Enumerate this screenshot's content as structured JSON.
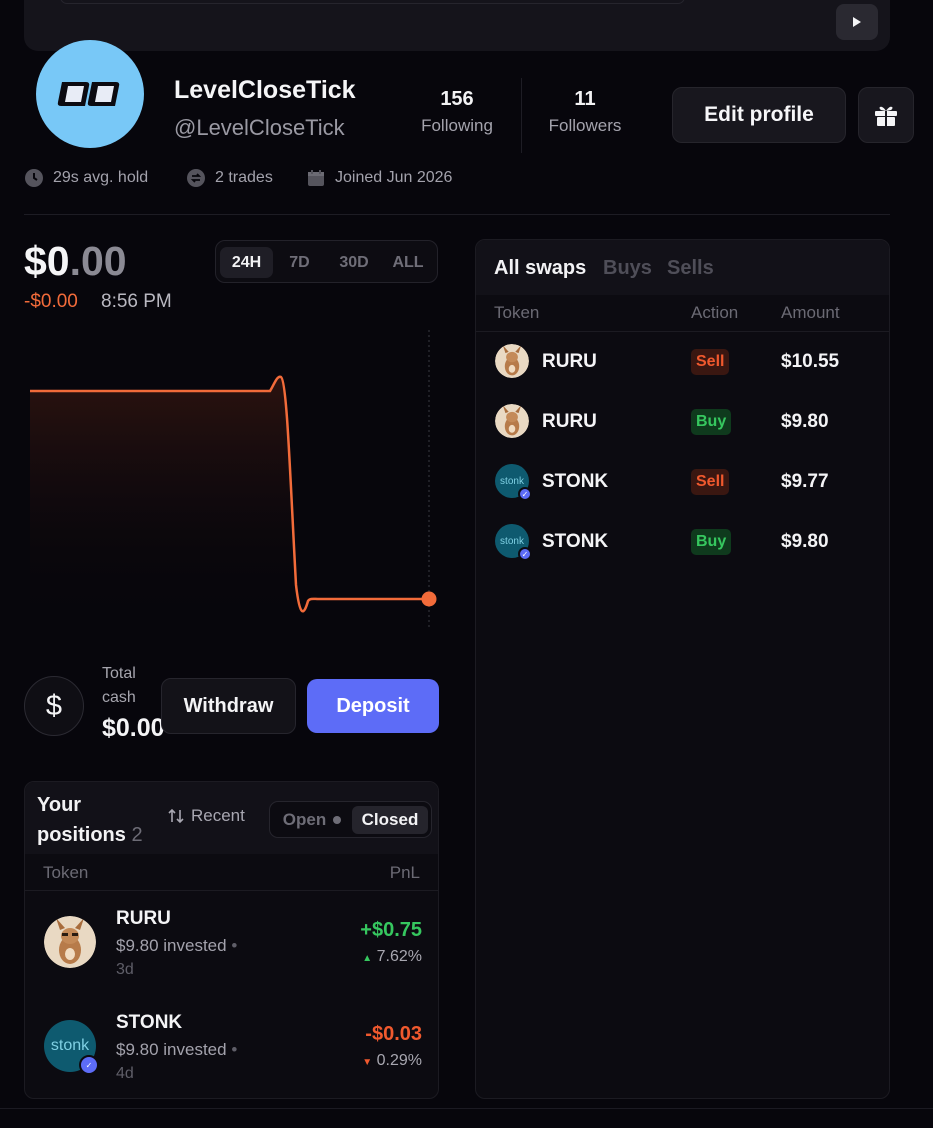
{
  "profile": {
    "name": "LevelCloseTick",
    "handle": "@LevelCloseTick",
    "following_count": "156",
    "following_label": "Following",
    "followers_count": "11",
    "followers_label": "Followers",
    "edit_label": "Edit profile",
    "avg_hold": "29s avg. hold",
    "trades": "2 trades",
    "joined": "Joined Jun 2026"
  },
  "portfolio": {
    "balance_main": "$0",
    "balance_cents": ".00",
    "delta": "-$0.00",
    "time": "8:56 PM",
    "ranges": [
      "24H",
      "7D",
      "30D",
      "ALL"
    ],
    "active_range": "24H",
    "line_color": "#f26b3a"
  },
  "cash": {
    "label": "Total cash",
    "value": "$0.00",
    "withdraw_label": "Withdraw",
    "deposit_label": "Deposit"
  },
  "positions": {
    "title_line1": "Your",
    "title_line2": "positions",
    "count": "2",
    "sort_label": "Recent",
    "open_label": "Open",
    "closed_label": "Closed",
    "col_token": "Token",
    "col_pnl": "PnL",
    "rows": [
      {
        "name": "RURU",
        "invested": "$9.80 invested",
        "age": "3d",
        "pnl": "+$0.75",
        "pct": "7.62%",
        "direction": "up",
        "avatar": "kangaroo"
      },
      {
        "name": "STONK",
        "invested": "$9.80 invested",
        "age": "4d",
        "pnl": "-$0.03",
        "pct": "0.29%",
        "direction": "down",
        "avatar": "stonk"
      }
    ]
  },
  "swaps": {
    "tabs": [
      "All swaps",
      "Buys",
      "Sells"
    ],
    "active_tab": "All swaps",
    "col_token": "Token",
    "col_action": "Action",
    "col_amount": "Amount",
    "rows": [
      {
        "token": "RURU",
        "action": "Sell",
        "amount": "$10.55",
        "avatar": "kangaroo"
      },
      {
        "token": "RURU",
        "action": "Buy",
        "amount": "$9.80",
        "avatar": "kangaroo"
      },
      {
        "token": "STONK",
        "action": "Sell",
        "amount": "$9.77",
        "avatar": "stonk"
      },
      {
        "token": "STONK",
        "action": "Buy",
        "amount": "$9.80",
        "avatar": "stonk"
      }
    ]
  },
  "colors": {
    "accent": "#5d6cf7",
    "positive": "#36c75f",
    "negative": "#f0592e",
    "avatar_bg": "#78c8f7"
  }
}
